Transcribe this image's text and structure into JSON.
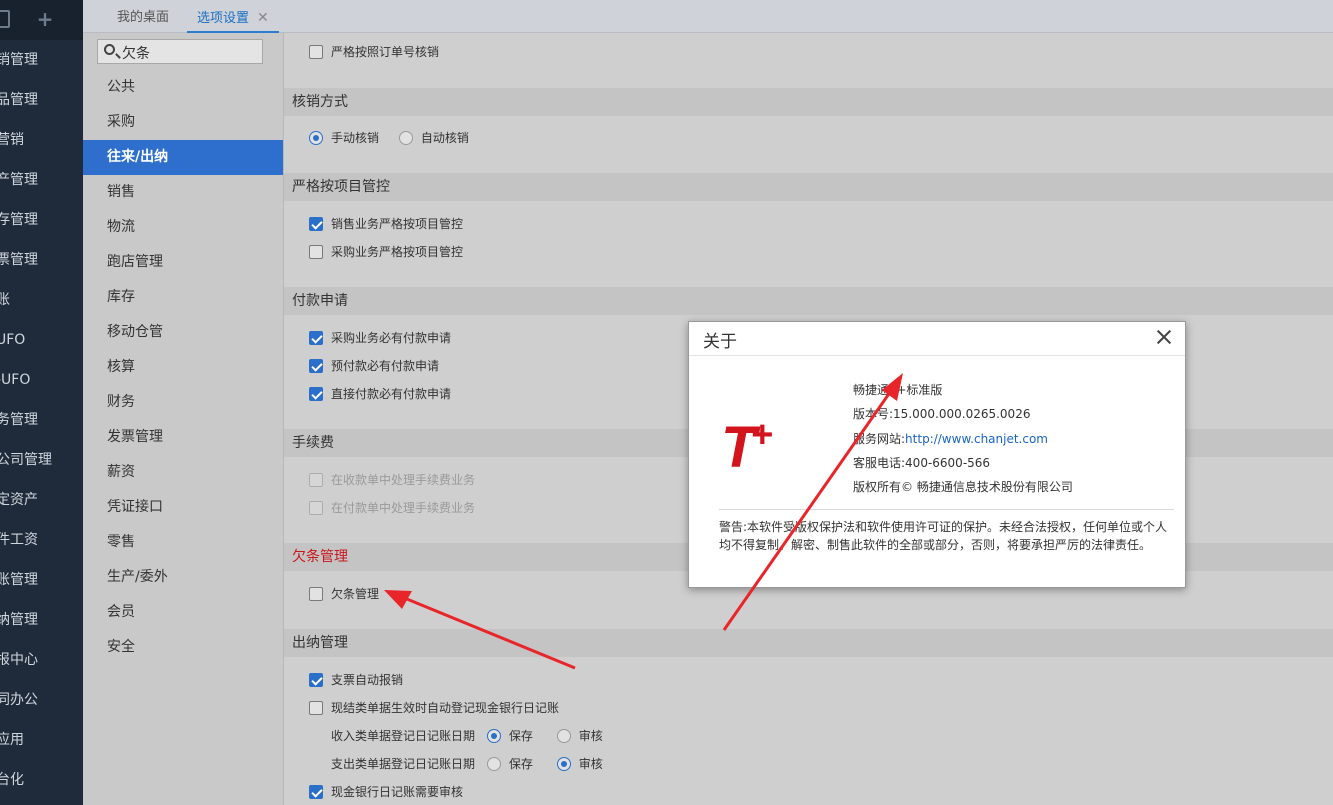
{
  "left_nav": {
    "items": [
      "销管理",
      "品管理",
      "营销",
      "产管理",
      "存管理",
      "票管理",
      "账",
      "UFO",
      "-UFO",
      "务管理",
      "公司管理",
      "定资产",
      "件工资",
      "账管理",
      "纳管理",
      "报中心",
      "同办公",
      "应用",
      "台化"
    ]
  },
  "tabs": [
    {
      "label": "我的桌面"
    },
    {
      "label": "选项设置",
      "close": "✕"
    }
  ],
  "search": {
    "value": "欠条"
  },
  "categories": {
    "items": [
      "公共",
      "采购",
      "往来/出纳",
      "销售",
      "物流",
      "跑店管理",
      "库存",
      "移动仓管",
      "核算",
      "财务",
      "发票管理",
      "薪资",
      "凭证接口",
      "零售",
      "生产/委外",
      "会员",
      "安全"
    ],
    "selected": "往来/出纳"
  },
  "main": {
    "top_option": "严格按照订单号核销",
    "hexiao": {
      "title": "核销方式",
      "manual": "手动核销",
      "auto": "自动核销",
      "selected": "手动核销"
    },
    "project": {
      "title": "严格按项目管控",
      "sales": "销售业务严格按项目管控",
      "sales_checked": true,
      "purchase": "采购业务严格按项目管控",
      "purchase_checked": false
    },
    "payment": {
      "title": "付款申请",
      "opt1": "采购业务必有付款申请",
      "opt2": "预付款必有付款申请",
      "opt3": "直接付款必有付款申请"
    },
    "fee": {
      "title": "手续费",
      "opt1": "在收款单中处理手续费业务",
      "opt2": "在付款单中处理手续费业务"
    },
    "iou": {
      "title": "欠条管理",
      "opt1": "欠条管理",
      "checked": false
    },
    "cashier": {
      "title": "出纳管理",
      "opt1": "支票自动报销",
      "opt2": "现结类单据生效时自动登记现金银行日记账",
      "income_label": "收入类单据登记日记账日期",
      "expense_label": "支出类单据登记日记账日期",
      "save": "保存",
      "audit": "审核",
      "income_selected": "保存",
      "expense_selected": "审核",
      "opt3": "现金银行日记账需要审核"
    }
  },
  "about": {
    "title": "关于",
    "logo_text": "T+",
    "product": "畅捷通T+标准版",
    "version": "版本号:15.000.000.0265.0026",
    "website_label": "服务网站:",
    "website_url": "http://www.chanjet.com",
    "phone": "客服电话:400-6600-566",
    "copyright": "版权所有© 畅捷通信息技术股份有限公司",
    "warning": "警告:本软件受版权保护法和软件使用许可证的保护。未经合法授权，任何单位或个人均不得复制、解密、制售此软件的全部或部分，否则，将要承担严厉的法律责任。"
  },
  "colors": {
    "accent": "#2e6fce",
    "annotation_arrow": "#e8262a",
    "logo_red": "#d4141c"
  }
}
